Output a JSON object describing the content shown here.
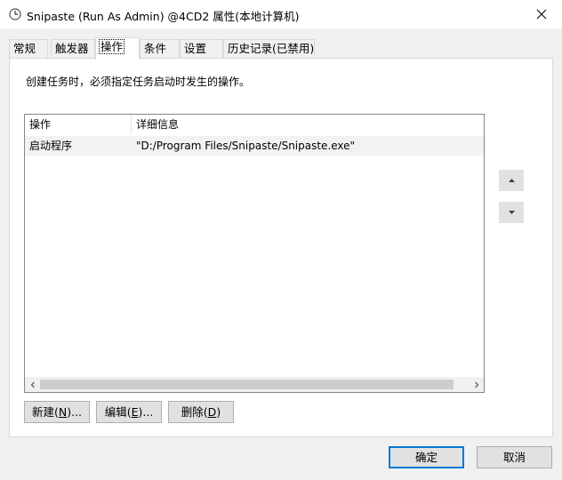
{
  "window": {
    "title": "Snipaste (Run As Admin) @4CD2 属性(本地计算机)",
    "icon": "clock-icon",
    "close_glyph": "✕"
  },
  "tabs": [
    {
      "label": "常规",
      "active": false
    },
    {
      "label": "触发器",
      "active": false
    },
    {
      "label": "操作",
      "active": true
    },
    {
      "label": "条件",
      "active": false
    },
    {
      "label": "设置",
      "active": false
    },
    {
      "label": "历史记录(已禁用)",
      "active": false
    }
  ],
  "panel": {
    "description": "创建任务时，必须指定任务启动时发生的操作。"
  },
  "list": {
    "columns": [
      "操作",
      "详细信息"
    ],
    "rows": [
      {
        "action": "启动程序",
        "detail": "\"D:/Program Files/Snipaste/Snipaste.exe\""
      }
    ]
  },
  "buttons": {
    "new": {
      "text": "新建(",
      "key": "N",
      "suffix": ")..."
    },
    "edit": {
      "text": "编辑(",
      "key": "E",
      "suffix": ")..."
    },
    "delete": {
      "text": "删除(",
      "key": "D",
      "suffix": ")"
    },
    "ok": "确定",
    "cancel": "取消"
  },
  "colors": {
    "accent": "#0078d7",
    "panel_bg": "#ffffff",
    "window_bg": "#f0f0f0",
    "selected_row": "#f2f2f2"
  }
}
